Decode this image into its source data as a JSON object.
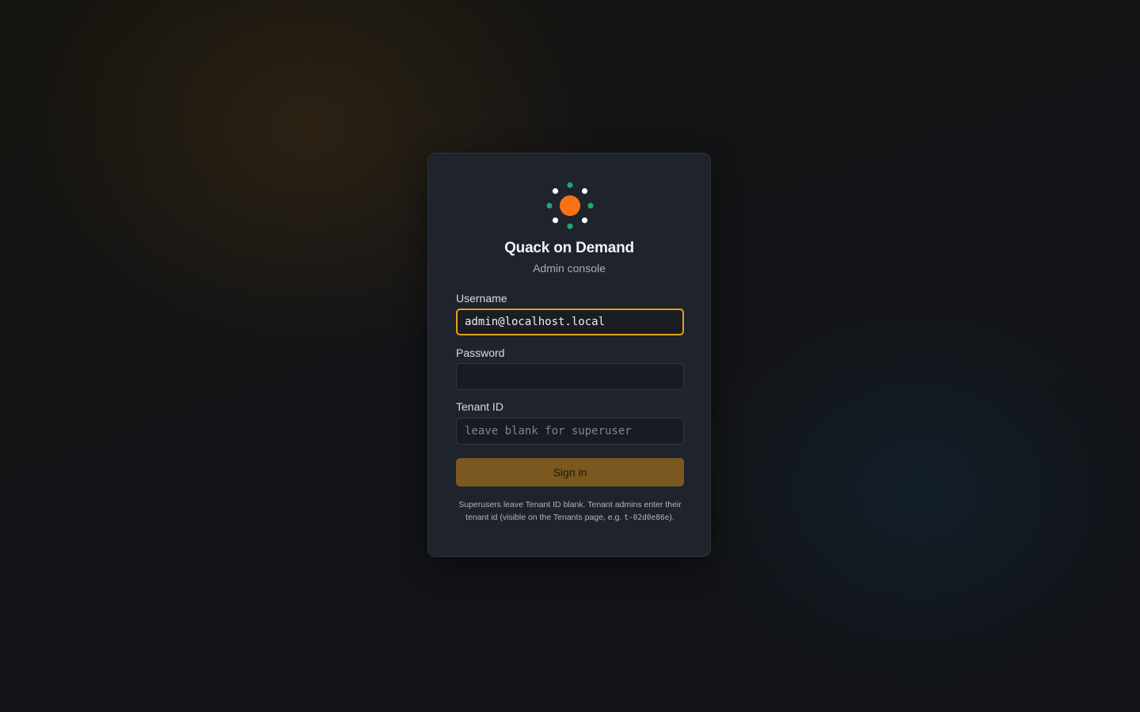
{
  "app": {
    "title": "Quack on Demand",
    "subtitle": "Admin console",
    "logo_icon": "duck-sun-logo-icon"
  },
  "colors": {
    "accent": "#e3a21a",
    "button_bg": "#7a5820",
    "logo_center": "#f97316",
    "logo_green": "#22a86b",
    "logo_white": "#ffffff"
  },
  "form": {
    "username": {
      "label": "Username",
      "value": "admin@localhost.local",
      "placeholder": ""
    },
    "password": {
      "label": "Password",
      "value": "",
      "placeholder": ""
    },
    "tenant": {
      "label": "Tenant ID",
      "value": "",
      "placeholder": "leave blank for superuser"
    },
    "submit_label": "Sign in"
  },
  "hint": {
    "text_before": "Superusers leave Tenant ID blank. Tenant admins enter their tenant id (visible on the Tenants page, e.g. ",
    "example_id": "t-02d0e86e",
    "text_after": ")."
  }
}
